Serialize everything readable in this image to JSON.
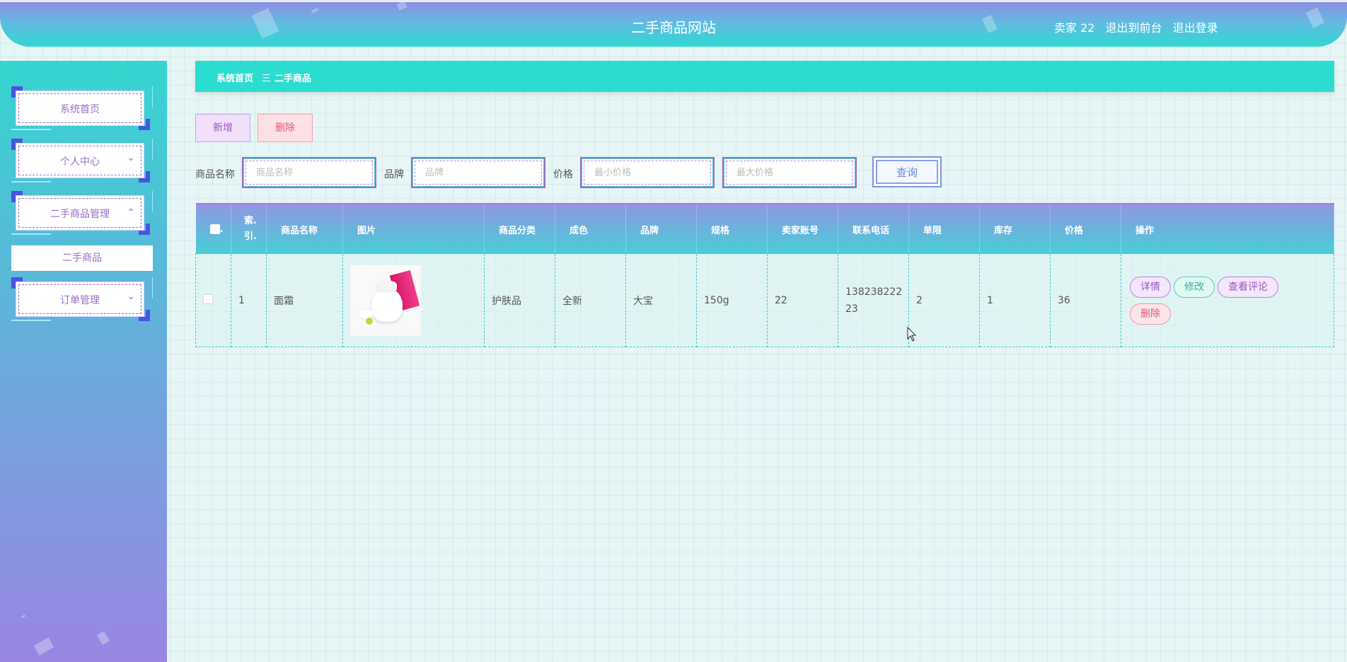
{
  "header": {
    "title": "二手商品网站",
    "user": "卖家 22",
    "link_front": "退出到前台",
    "link_logout": "退出登录"
  },
  "sidebar": {
    "items": [
      {
        "label": "系统首页"
      },
      {
        "label": "个人中心",
        "arrow": "⌄"
      },
      {
        "label": "二手商品管理",
        "arrow": "⌃"
      },
      {
        "label": "订单管理",
        "arrow": "⌄"
      }
    ],
    "submenu": [
      "二手商品"
    ]
  },
  "breadcrumb": {
    "home": "系统首页",
    "sep": "三",
    "current": "二手商品"
  },
  "toolbar": {
    "add_label": "新增",
    "delete_label": "删除"
  },
  "search": {
    "name_label": "商品名称",
    "name_placeholder": "商品名称",
    "brand_label": "品牌",
    "brand_placeholder": "品牌",
    "price_label": "价格",
    "min_placeholder": "最小价格",
    "max_placeholder": "最大价格",
    "button_label": "查询"
  },
  "table": {
    "headers": [
      "索引",
      "商品名称",
      "图片",
      "商品分类",
      "成色",
      "品牌",
      "规格",
      "卖家账号",
      "联系电话",
      "单限",
      "库存",
      "价格",
      "操作"
    ],
    "header_index_top": "索.",
    "header_index_bottom": "引.",
    "rows": [
      {
        "index": "1",
        "name": "面霜",
        "category": "护肤品",
        "condition": "全新",
        "brand": "大宝",
        "spec": "150g",
        "seller": "22",
        "phone_line1": "138238222",
        "phone_line2": "23",
        "limit": "2",
        "stock": "1",
        "price": "36",
        "image": "product-image"
      }
    ],
    "ops": {
      "detail": "详情",
      "edit": "修改",
      "review": "查看评论",
      "delete": "删除"
    }
  },
  "colors": {
    "primary_teal": "#2bddd0",
    "purple": "#9a6cc8",
    "danger": "#e05a78"
  }
}
